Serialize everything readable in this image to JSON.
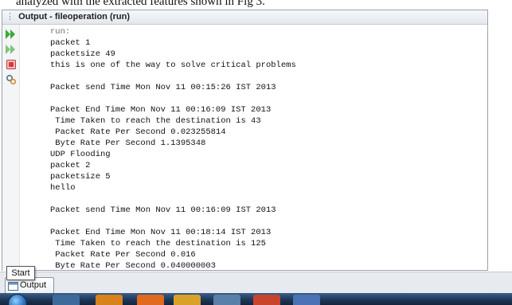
{
  "document": {
    "line_above": "analyzed with the extracted features shown in Fig 3."
  },
  "panel": {
    "title": "Output - fileoperation (run)",
    "toolbar_icons": [
      "rerun-icon",
      "rerun-with-options-icon",
      "stop-icon",
      "settings-icon"
    ]
  },
  "console": {
    "lines": [
      {
        "text": "run:",
        "style": "dim"
      },
      {
        "text": "packet 1",
        "style": "normal"
      },
      {
        "text": "packetsize 49",
        "style": "normal"
      },
      {
        "text": "this is one of the way to solve critical problems",
        "style": "normal"
      },
      {
        "text": "",
        "style": "normal"
      },
      {
        "text": "Packet send Time Mon Nov 11 00:15:26 IST 2013",
        "style": "normal"
      },
      {
        "text": "",
        "style": "normal"
      },
      {
        "text": "Packet End Time Mon Nov 11 00:16:09 IST 2013",
        "style": "normal"
      },
      {
        "text": " Time Taken to reach the destination is 43",
        "style": "normal"
      },
      {
        "text": " Packet Rate Per Second 0.023255814",
        "style": "normal"
      },
      {
        "text": " Byte Rate Per Second 1.1395348",
        "style": "normal"
      },
      {
        "text": "UDP Flooding",
        "style": "normal"
      },
      {
        "text": "packet 2",
        "style": "normal"
      },
      {
        "text": "packetsize 5",
        "style": "normal"
      },
      {
        "text": "hello",
        "style": "normal"
      },
      {
        "text": "",
        "style": "normal"
      },
      {
        "text": "Packet send Time Mon Nov 11 00:16:09 IST 2013",
        "style": "normal"
      },
      {
        "text": "",
        "style": "normal"
      },
      {
        "text": "Packet End Time Mon Nov 11 00:18:14 IST 2013",
        "style": "normal"
      },
      {
        "text": " Time Taken to reach the destination is 125",
        "style": "normal"
      },
      {
        "text": " Packet Rate Per Second 0.016",
        "style": "normal"
      },
      {
        "text": " Byte Rate Per Second 0.040000003",
        "style": "normal"
      }
    ]
  },
  "tabs": {
    "output_label": "Output"
  },
  "tooltip": {
    "start_label": "Start"
  },
  "taskbar": {
    "apps": [
      "windows-explorer",
      "media-player",
      "firefox",
      "chrome",
      "virtualbox",
      "powerpoint",
      "word"
    ]
  },
  "colors": {
    "rerun_green": "#3aa935",
    "stop_red": "#d23b3b",
    "taskbar_blue": "#1e3658"
  }
}
